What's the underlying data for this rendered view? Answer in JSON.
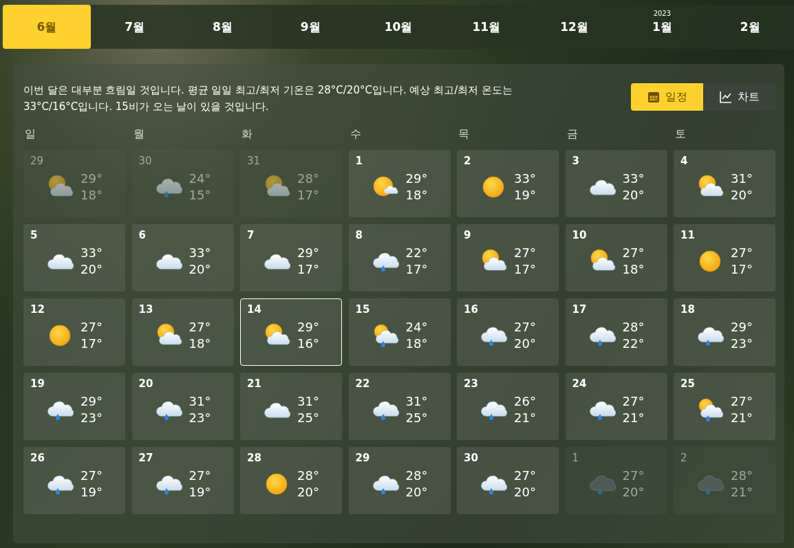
{
  "months": [
    {
      "label": "6월",
      "selected": true
    },
    {
      "label": "7월",
      "selected": false
    },
    {
      "label": "8월",
      "selected": false
    },
    {
      "label": "9월",
      "selected": false
    },
    {
      "label": "10월",
      "selected": false
    },
    {
      "label": "11월",
      "selected": false
    },
    {
      "label": "12월",
      "selected": false
    },
    {
      "label": "1월",
      "year": "2023",
      "selected": false
    },
    {
      "label": "2월",
      "selected": false
    }
  ],
  "summary": "이번 달은 대부분 흐림일 것입니다. 평균 일일 최고/최저 기온은 28°C/20°C입니다. 예상 최고/최저 온도는 33°C/16°C입니다. 15비가 오는 날이 있을 것입니다.",
  "view_toggle": [
    {
      "label": "일정",
      "kind": "calendar",
      "selected": true
    },
    {
      "label": "차트",
      "kind": "chart",
      "selected": false
    }
  ],
  "weekdays": [
    "일",
    "월",
    "화",
    "수",
    "목",
    "금",
    "토"
  ],
  "days": [
    {
      "date": "29",
      "kind": "sun-cloud",
      "high": "29°",
      "low": "18°",
      "dimmed": true,
      "selected": false
    },
    {
      "date": "30",
      "kind": "rain",
      "high": "24°",
      "low": "15°",
      "dimmed": true,
      "selected": false
    },
    {
      "date": "31",
      "kind": "sun-cloud",
      "high": "28°",
      "low": "17°",
      "dimmed": true,
      "selected": false
    },
    {
      "date": "1",
      "kind": "sun-small-cloud",
      "high": "29°",
      "low": "18°",
      "dimmed": false,
      "selected": false
    },
    {
      "date": "2",
      "kind": "sun",
      "high": "33°",
      "low": "19°",
      "dimmed": false,
      "selected": false
    },
    {
      "date": "3",
      "kind": "cloud",
      "high": "33°",
      "low": "20°",
      "dimmed": false,
      "selected": false
    },
    {
      "date": "4",
      "kind": "sun-cloud",
      "high": "31°",
      "low": "20°",
      "dimmed": false,
      "selected": false
    },
    {
      "date": "5",
      "kind": "cloud",
      "high": "33°",
      "low": "20°",
      "dimmed": false,
      "selected": false
    },
    {
      "date": "6",
      "kind": "cloud",
      "high": "33°",
      "low": "20°",
      "dimmed": false,
      "selected": false
    },
    {
      "date": "7",
      "kind": "cloud",
      "high": "29°",
      "low": "17°",
      "dimmed": false,
      "selected": false
    },
    {
      "date": "8",
      "kind": "rain",
      "high": "22°",
      "low": "17°",
      "dimmed": false,
      "selected": false
    },
    {
      "date": "9",
      "kind": "sun-cloud",
      "high": "27°",
      "low": "17°",
      "dimmed": false,
      "selected": false
    },
    {
      "date": "10",
      "kind": "sun-cloud",
      "high": "27°",
      "low": "18°",
      "dimmed": false,
      "selected": false
    },
    {
      "date": "11",
      "kind": "sun",
      "high": "27°",
      "low": "17°",
      "dimmed": false,
      "selected": false
    },
    {
      "date": "12",
      "kind": "sun",
      "high": "27°",
      "low": "17°",
      "dimmed": false,
      "selected": false
    },
    {
      "date": "13",
      "kind": "sun-cloud",
      "high": "27°",
      "low": "18°",
      "dimmed": false,
      "selected": false
    },
    {
      "date": "14",
      "kind": "sun-cloud",
      "high": "29°",
      "low": "16°",
      "dimmed": false,
      "selected": true
    },
    {
      "date": "15",
      "kind": "sun-rain",
      "high": "24°",
      "low": "18°",
      "dimmed": false,
      "selected": false
    },
    {
      "date": "16",
      "kind": "rain",
      "high": "27°",
      "low": "20°",
      "dimmed": false,
      "selected": false
    },
    {
      "date": "17",
      "kind": "rain",
      "high": "28°",
      "low": "22°",
      "dimmed": false,
      "selected": false
    },
    {
      "date": "18",
      "kind": "rain",
      "high": "29°",
      "low": "23°",
      "dimmed": false,
      "selected": false
    },
    {
      "date": "19",
      "kind": "rain",
      "high": "29°",
      "low": "23°",
      "dimmed": false,
      "selected": false
    },
    {
      "date": "20",
      "kind": "rain",
      "high": "31°",
      "low": "23°",
      "dimmed": false,
      "selected": false
    },
    {
      "date": "21",
      "kind": "cloud",
      "high": "31°",
      "low": "25°",
      "dimmed": false,
      "selected": false
    },
    {
      "date": "22",
      "kind": "rain",
      "high": "31°",
      "low": "25°",
      "dimmed": false,
      "selected": false
    },
    {
      "date": "23",
      "kind": "rain",
      "high": "26°",
      "low": "21°",
      "dimmed": false,
      "selected": false
    },
    {
      "date": "24",
      "kind": "rain",
      "high": "27°",
      "low": "21°",
      "dimmed": false,
      "selected": false
    },
    {
      "date": "25",
      "kind": "sun-rain",
      "high": "27°",
      "low": "21°",
      "dimmed": false,
      "selected": false
    },
    {
      "date": "26",
      "kind": "rain",
      "high": "27°",
      "low": "19°",
      "dimmed": false,
      "selected": false
    },
    {
      "date": "27",
      "kind": "rain",
      "high": "27°",
      "low": "19°",
      "dimmed": false,
      "selected": false
    },
    {
      "date": "28",
      "kind": "sun",
      "high": "28°",
      "low": "20°",
      "dimmed": false,
      "selected": false
    },
    {
      "date": "29",
      "kind": "rain",
      "high": "28°",
      "low": "20°",
      "dimmed": false,
      "selected": false
    },
    {
      "date": "30",
      "kind": "rain",
      "high": "27°",
      "low": "20°",
      "dimmed": false,
      "selected": false
    },
    {
      "date": "1",
      "kind": "dark-rain",
      "high": "27°",
      "low": "20°",
      "dimmed": true,
      "selected": false
    },
    {
      "date": "2",
      "kind": "dark-rain",
      "high": "28°",
      "low": "21°",
      "dimmed": true,
      "selected": false
    }
  ]
}
